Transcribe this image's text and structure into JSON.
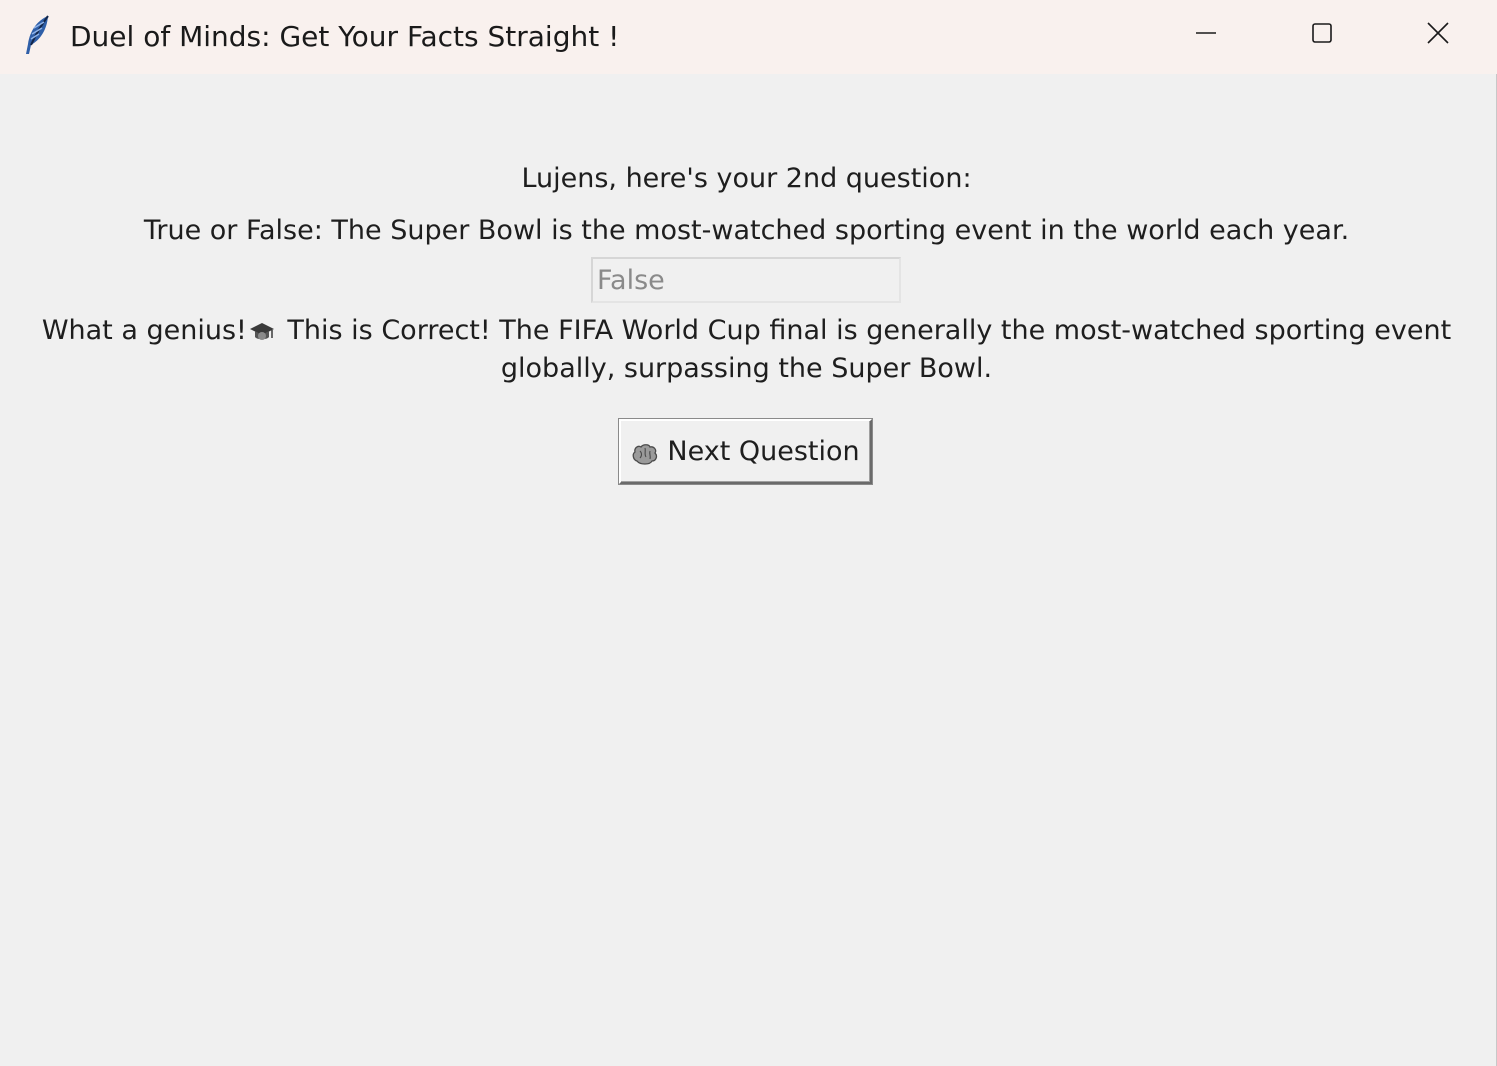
{
  "window": {
    "title": "Duel of Minds: Get Your Facts Straight !",
    "controls": {
      "minimize_icon": "minimize-icon",
      "maximize_icon": "maximize-icon",
      "close_icon": "close-icon"
    },
    "app_icon": "feather-icon"
  },
  "quiz": {
    "greeting": "Lujens, here's your 2nd question:",
    "question": "True or False: The Super Bowl is the most-watched sporting event in the world each year.",
    "answer_value": "False",
    "feedback_prefix": "What a genius!",
    "feedback_emoji": "graduation-cap-icon",
    "feedback_rest": " This is Correct! The FIFA World Cup final is generally the most-watched sporting event globally, surpassing the Super Bowl.",
    "next_button": {
      "icon": "brain-icon",
      "label": "Next Question"
    }
  },
  "colors": {
    "titlebar_bg": "#f9f1ee",
    "window_bg": "#f0f0f0",
    "text": "#1e1e1e",
    "input_text": "#8a8a8a"
  }
}
